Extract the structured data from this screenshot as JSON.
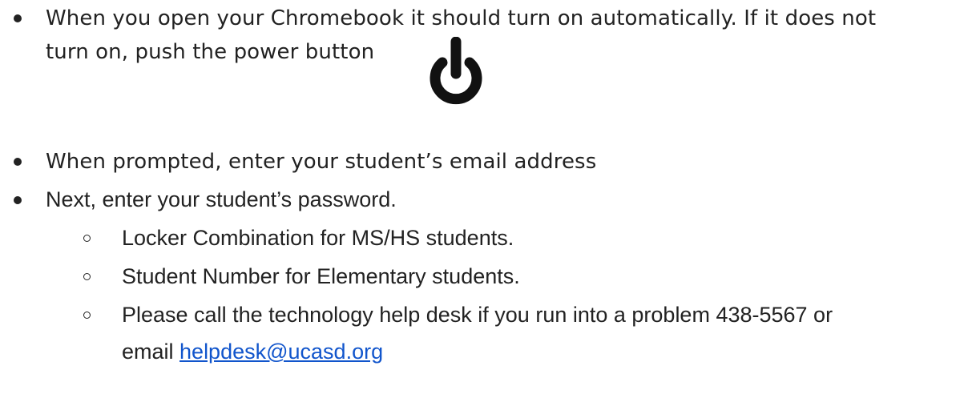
{
  "items": [
    {
      "line1": "When you open your Chromebook it should turn on automatically.  If it does not",
      "line2": "turn on, push the power button"
    },
    {
      "text": "When prompted, enter your student’s email address"
    },
    {
      "text": "Next, enter your student’s password.",
      "subitems": [
        {
          "text": "Locker Combination for MS/HS students."
        },
        {
          "text": "Student Number for Elementary students."
        },
        {
          "line1": "Please call the technology help desk if you run into a problem 438-5567 or",
          "line2_prefix": "email ",
          "link": "helpdesk@ucasd.org"
        }
      ]
    }
  ],
  "icons": {
    "power": "power-icon"
  },
  "colors": {
    "text": "#222222",
    "link": "#1155cc"
  }
}
